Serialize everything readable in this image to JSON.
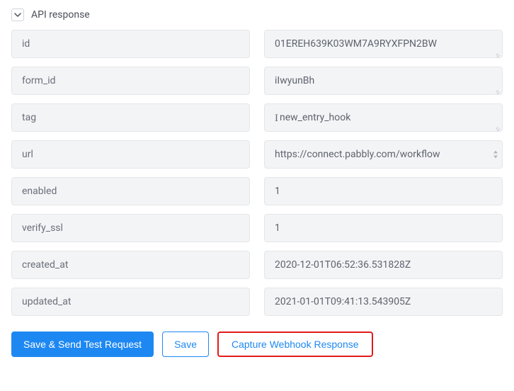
{
  "section": {
    "title": "API response"
  },
  "fields": [
    {
      "key": "id",
      "value": "01EREH639K03WM7A9RYXFPN2BW",
      "resizable": true,
      "scrollable": false,
      "showCursor": false
    },
    {
      "key": "form_id",
      "value": "iIwyunBh",
      "resizable": true,
      "scrollable": false,
      "showCursor": false
    },
    {
      "key": "tag",
      "value": "new_entry_hook",
      "resizable": true,
      "scrollable": false,
      "showCursor": true
    },
    {
      "key": "url",
      "value": "https://connect.pabbly.com/workflow",
      "resizable": false,
      "scrollable": true,
      "showCursor": false
    },
    {
      "key": "enabled",
      "value": "1",
      "resizable": false,
      "scrollable": false,
      "showCursor": false
    },
    {
      "key": "verify_ssl",
      "value": "1",
      "resizable": false,
      "scrollable": false,
      "showCursor": false
    },
    {
      "key": "created_at",
      "value": "2020-12-01T06:52:36.531828Z",
      "resizable": false,
      "scrollable": false,
      "showCursor": false
    },
    {
      "key": "updated_at",
      "value": "2021-01-01T09:41:13.543905Z",
      "resizable": false,
      "scrollable": false,
      "showCursor": false
    }
  ],
  "buttons": {
    "primary": "Save & Send Test Request",
    "save": "Save",
    "capture": "Capture Webhook Response"
  }
}
